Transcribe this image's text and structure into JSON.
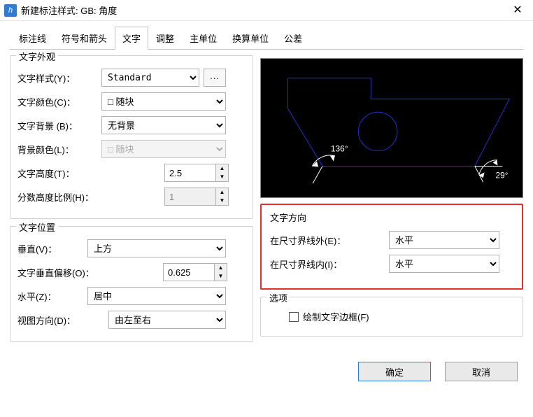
{
  "window": {
    "title": "新建标注样式: GB: 角度"
  },
  "tabs": [
    "标注线",
    "符号和箭头",
    "文字",
    "调整",
    "主单位",
    "换算单位",
    "公差"
  ],
  "active_tab": "文字",
  "appearance": {
    "title": "文字外观",
    "style_label": "文字样式(Y)：",
    "style_value": "Standard",
    "style_btn": "...",
    "color_label": "文字颜色(C)：",
    "color_value": "随块",
    "bg_label": "文字背景 (B)：",
    "bg_value": "无背景",
    "bgcolor_label": "背景颜色(L)：",
    "bgcolor_value": "随块",
    "height_label": "文字高度(T)：",
    "height_value": "2.5",
    "frac_label": "分数高度比例(H)：",
    "frac_value": "1"
  },
  "placement": {
    "title": "文字位置",
    "vert_label": "垂直(V)：",
    "vert_value": "上方",
    "offset_label": "文字垂直偏移(O)：",
    "offset_value": "0.625",
    "horiz_label": "水平(Z)：",
    "horiz_value": "居中",
    "viewdir_label": "视图方向(D)：",
    "viewdir_value": "由左至右"
  },
  "direction": {
    "title": "文字方向",
    "outside_label": "在尺寸界线外(E)：",
    "outside_value": "水平",
    "inside_label": "在尺寸界线内(I)：",
    "inside_value": "水平"
  },
  "options": {
    "title": "选项",
    "frame_label": "绘制文字边框(F)"
  },
  "preview": {
    "angle1": "136°",
    "angle2": "29°"
  },
  "buttons": {
    "ok": "确定",
    "cancel": "取消"
  }
}
